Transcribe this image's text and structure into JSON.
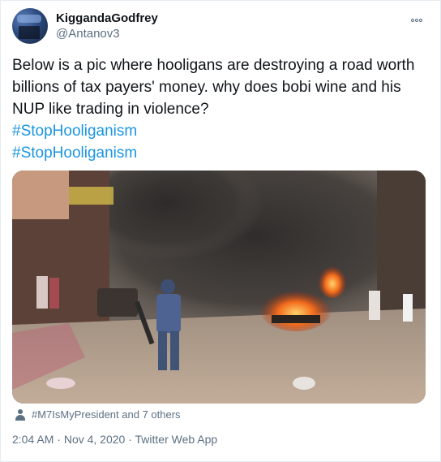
{
  "author": {
    "display_name": "KiggandaGodfrey",
    "handle": "@Antanov3"
  },
  "icons": {
    "avatar": "avatar-image",
    "more": "more-options-icon",
    "context": "person-icon"
  },
  "tweet": {
    "text": "Below is a pic where hooligans are destroying a road worth billions of tax payers' money. why does bobi wine and his NUP like trading in violence?",
    "hashtags": [
      "#StopHooliganism",
      "#StopHooliganism"
    ]
  },
  "media": {
    "kind": "photo"
  },
  "social_context": {
    "label": "#M7IsMyPresident and 7 others"
  },
  "meta": {
    "time": "2:04 AM",
    "separator": "·",
    "date": "Nov 4, 2020",
    "source": "Twitter Web App"
  },
  "colors": {
    "link": "#1b95e0",
    "secondary_text": "#5b7083",
    "primary_text": "#0f1419"
  }
}
